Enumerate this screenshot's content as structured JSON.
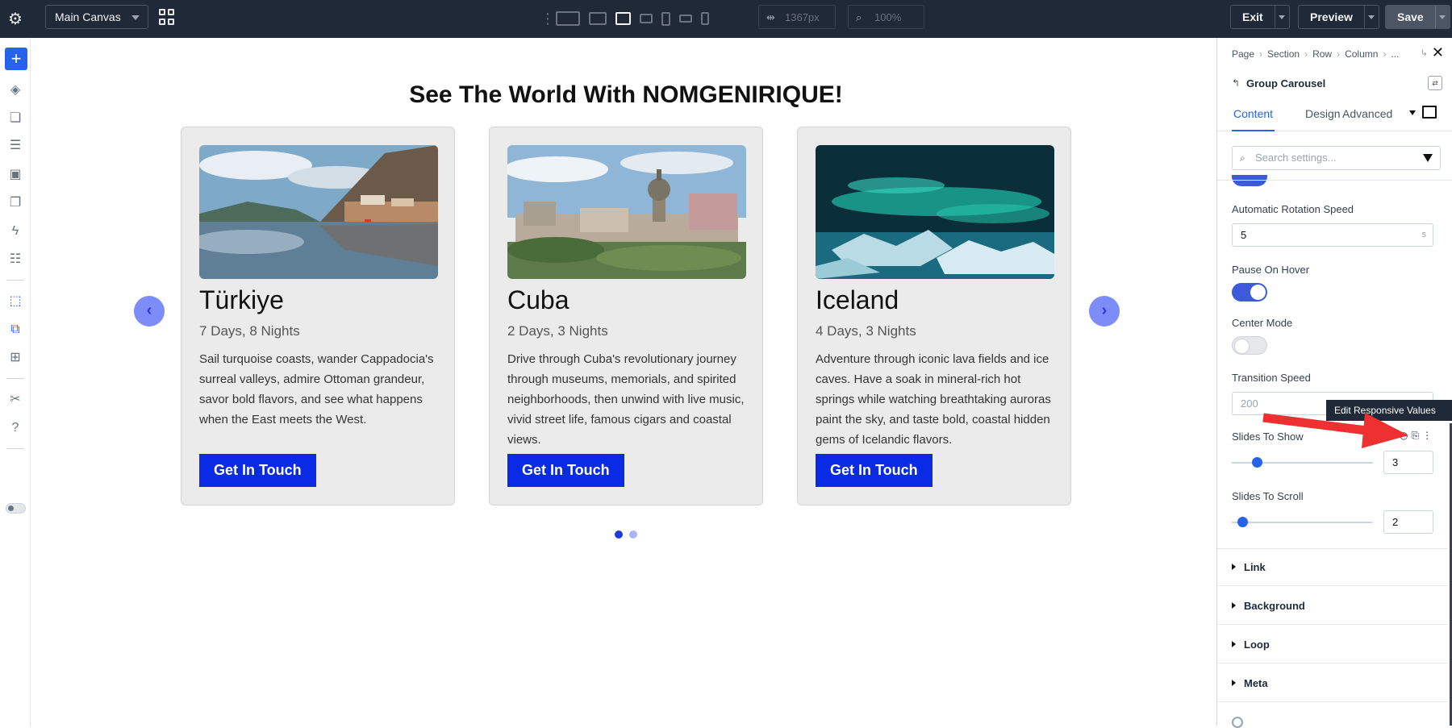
{
  "topbar": {
    "canvas_select": "Main Canvas",
    "width_value": "1367px",
    "zoom_value": "100%",
    "exit_label": "Exit",
    "preview_label": "Preview",
    "save_label": "Save"
  },
  "canvas": {
    "heading": "See The World With NOMGENIRIQUE!",
    "prev_arrow": "‹",
    "next_arrow": "›",
    "cards": [
      {
        "title": "Türkiye",
        "subtitle": "7 Days, 8 Nights",
        "description": "Sail turquoise coasts, wander Cappadocia's surreal valleys, admire Ottoman grandeur, savor bold flavors, and see what happens when the East meets the West.",
        "button": "Get In Touch"
      },
      {
        "title": "Cuba",
        "subtitle": "2 Days, 3 Nights",
        "description": "Drive through Cuba's revolutionary journey through museums, memorials, and spirited neighborhoods, then unwind with live music, vivid street life, famous cigars and coastal views.",
        "button": "Get In Touch"
      },
      {
        "title": "Iceland",
        "subtitle": "4 Days, 3 Nights",
        "description": "Adventure through iconic lava fields and ice caves. Have a soak in mineral-rich hot springs while watching breathtaking auroras paint the sky, and taste bold, coastal hidden gems of Icelandic flavors.",
        "button": "Get In Touch"
      }
    ]
  },
  "panel": {
    "breadcrumbs": [
      "Page",
      "Section",
      "Row",
      "Column",
      "..."
    ],
    "module_title": "Group Carousel",
    "tabs": [
      "Content",
      "Design",
      "Advanced"
    ],
    "search_placeholder": "Search settings...",
    "settings": {
      "rotation_speed_label": "Automatic Rotation Speed",
      "rotation_speed_value": "5",
      "rotation_speed_unit": "s",
      "pause_on_hover_label": "Pause On Hover",
      "center_mode_label": "Center Mode",
      "transition_speed_label": "Transition Speed",
      "transition_speed_value": "200",
      "slides_to_show_label": "Slides To Show",
      "slides_to_show_value": "3",
      "slides_to_scroll_label": "Slides To Scroll",
      "slides_to_scroll_value": "2"
    },
    "tooltip": "Edit Responsive Values",
    "groups": [
      "Link",
      "Background",
      "Loop",
      "Meta"
    ]
  },
  "colors": {
    "topbar": "#1f2937",
    "accent": "#2563eb",
    "cta": "#0a2be6",
    "arrow": "#ef3030"
  }
}
